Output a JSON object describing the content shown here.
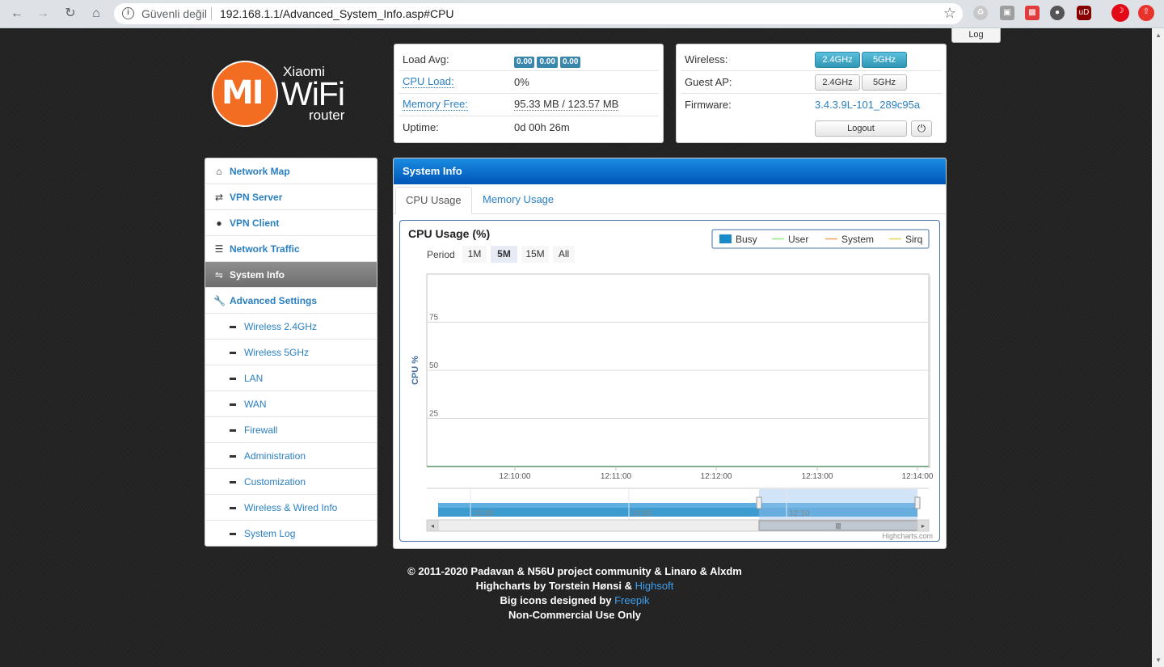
{
  "browser": {
    "security_text": "Güvenli değil",
    "url": "192.168.1.1/Advanced_System_Info.asp#CPU",
    "log_tab": "Log"
  },
  "logo": {
    "brand_mi": "MI",
    "xiaomi": "Xiaomi",
    "wifi": "WiFi",
    "router": "router",
    "accent": "#f26c21"
  },
  "status": {
    "load_avg_label": "Load Avg:",
    "load_avg": [
      "0.00",
      "0.00",
      "0.00"
    ],
    "cpu_load_label": "CPU Load:",
    "cpu_load": "0%",
    "memory_free_label": "Memory Free:",
    "memory_free": "95.33 MB / 123.57 MB",
    "uptime_label": "Uptime:",
    "uptime": "0d 00h 26m"
  },
  "controls": {
    "wireless_label": "Wireless:",
    "guest_ap_label": "Guest AP:",
    "firmware_label": "Firmware:",
    "band_24": "2.4GHz",
    "band_5": "5GHz",
    "firmware": "3.4.3.9L-101_289c95a",
    "logout": "Logout"
  },
  "sidebar": {
    "items": [
      {
        "label": "Network Map",
        "icon": "home-icon"
      },
      {
        "label": "VPN Server",
        "icon": "retweet-icon"
      },
      {
        "label": "VPN Client",
        "icon": "globe-icon"
      },
      {
        "label": "Network Traffic",
        "icon": "list-icon"
      },
      {
        "label": "System Info",
        "icon": "random-icon"
      },
      {
        "label": "Advanced Settings",
        "icon": "wrench-icon"
      }
    ],
    "sub_items": [
      "Wireless 2.4GHz",
      "Wireless 5GHz",
      "LAN",
      "WAN",
      "Firewall",
      "Administration",
      "Customization",
      "Wireless & Wired Info",
      "System Log"
    ]
  },
  "main": {
    "title": "System Info",
    "tabs": [
      "CPU Usage",
      "Memory Usage"
    ]
  },
  "chart_data": {
    "type": "area",
    "title": "CPU Usage (%)",
    "ylabel": "CPU %",
    "period_label": "Period",
    "periods": [
      "1M",
      "5M",
      "15M",
      "All"
    ],
    "selected_period": "5M",
    "legend": [
      {
        "name": "Busy",
        "color": "#1a8bc8"
      },
      {
        "name": "User",
        "color": "#90ed7d"
      },
      {
        "name": "System",
        "color": "#f7a35c"
      },
      {
        "name": "Sirq",
        "color": "#e4d354"
      }
    ],
    "ylim": [
      0,
      100
    ],
    "yticks": [
      25,
      50,
      75
    ],
    "xticks": [
      "12:10:00",
      "12:11:00",
      "12:12:00",
      "12:13:00",
      "12:14:00"
    ],
    "navigator_ticks": [
      "12:00",
      "12:05",
      "12:10"
    ],
    "series": [
      {
        "name": "Busy",
        "values": [
          0,
          0,
          0,
          0,
          0
        ]
      },
      {
        "name": "User",
        "values": [
          0,
          0,
          0,
          0,
          0
        ]
      },
      {
        "name": "System",
        "values": [
          0,
          0,
          0,
          0,
          0
        ]
      },
      {
        "name": "Sirq",
        "values": [
          0,
          0,
          0,
          0,
          0
        ]
      }
    ],
    "credit": "Highcharts.com"
  },
  "footer": {
    "copyright": "© 2011-2020 Padavan & N56U project community & Linaro & Alxdm",
    "highcharts_prefix": "Highcharts by Torstein Hønsi & ",
    "highcharts_link": "Highsoft",
    "icons_prefix": "Big icons designed by ",
    "icons_link": "Freepik",
    "license": "Non-Commercial Use Only"
  }
}
